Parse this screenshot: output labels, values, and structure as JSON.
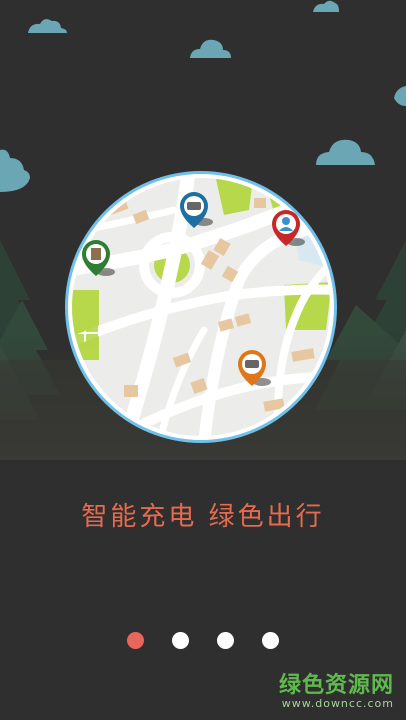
{
  "onboarding": {
    "tagline": "智能充电 绿色出行",
    "pager": {
      "total": 4,
      "active_index": 0
    }
  },
  "watermark": {
    "title": "绿色资源网",
    "url": "www.downcc.com"
  },
  "colors": {
    "background": "#2f2f2f",
    "accent": "#e66a4f",
    "active_dot": "#e8665a",
    "cloud": "#6aa6b4",
    "map_border": "#6fc1ea"
  },
  "map_pins": [
    {
      "icon": "car-icon",
      "color": "#1c6fa0"
    },
    {
      "icon": "person-icon",
      "color": "#c62828"
    },
    {
      "icon": "building-icon",
      "color": "#2e7d32"
    },
    {
      "icon": "car-icon",
      "color": "#e0761a"
    }
  ]
}
